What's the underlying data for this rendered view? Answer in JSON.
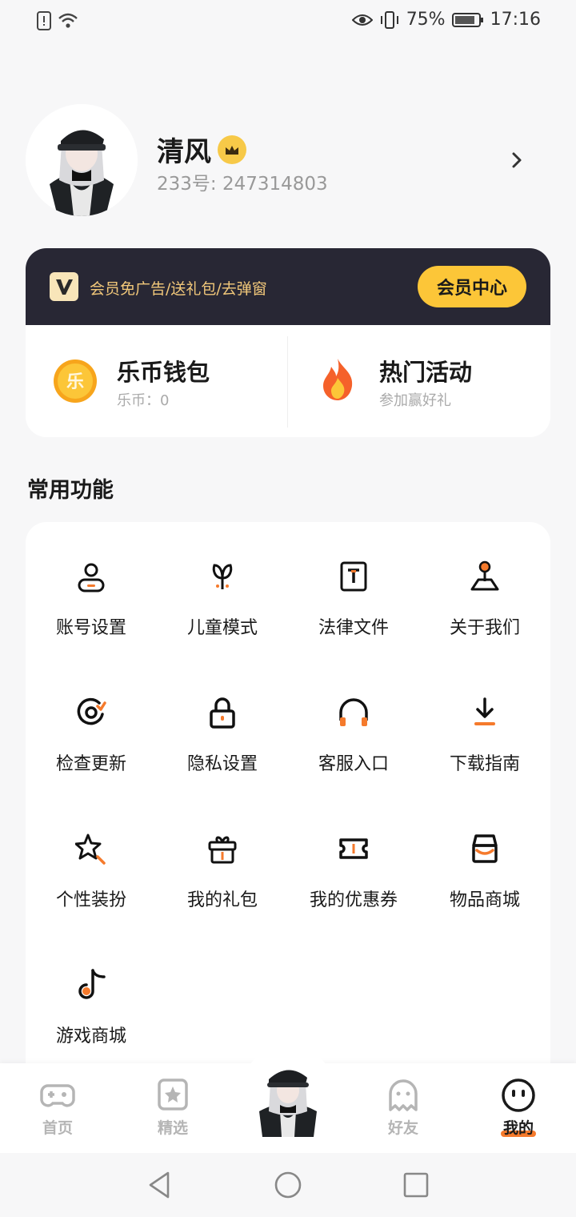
{
  "status_bar": {
    "battery": "75%",
    "time": "17:16"
  },
  "profile": {
    "name": "清风",
    "id_text": "233号: 247314803"
  },
  "vip": {
    "slogan": "会员免广告/送礼包/去弹窗",
    "button": "会员中心"
  },
  "wallet": {
    "title": "乐币钱包",
    "sub": "乐币：0",
    "coin_glyph": "乐"
  },
  "hot": {
    "title": "热门活动",
    "sub": "参加赢好礼"
  },
  "section_title": "常用功能",
  "functions": [
    {
      "label": "账号设置",
      "icon": "account-icon"
    },
    {
      "label": "儿童模式",
      "icon": "sprout-icon"
    },
    {
      "label": "法律文件",
      "icon": "document-icon"
    },
    {
      "label": "关于我们",
      "icon": "location-pin-icon"
    },
    {
      "label": "检查更新",
      "icon": "refresh-icon"
    },
    {
      "label": "隐私设置",
      "icon": "lock-icon"
    },
    {
      "label": "客服入口",
      "icon": "headset-icon"
    },
    {
      "label": "下载指南",
      "icon": "download-icon"
    },
    {
      "label": "个性装扮",
      "icon": "magic-star-icon"
    },
    {
      "label": "我的礼包",
      "icon": "gift-icon"
    },
    {
      "label": "我的优惠券",
      "icon": "ticket-icon"
    },
    {
      "label": "物品商城",
      "icon": "store-icon"
    },
    {
      "label": "游戏商城",
      "icon": "music-note-icon"
    }
  ],
  "nav": {
    "home": "首页",
    "featured": "精选",
    "friends": "好友",
    "mine": "我的"
  },
  "colors": {
    "accent": "#f57a2c",
    "vip_dark": "#282734",
    "vip_gold": "#fcc638"
  }
}
